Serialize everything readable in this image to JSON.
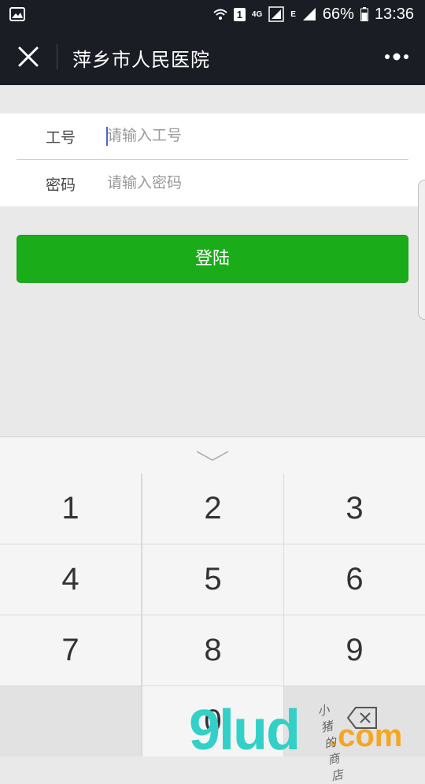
{
  "status_bar": {
    "sim_slot": "1",
    "network_type": "4G",
    "edge_label": "E",
    "battery": "66%",
    "time": "13:36"
  },
  "header": {
    "title": "萍乡市人民医院"
  },
  "form": {
    "id_label": "工号",
    "id_placeholder": "请输入工号",
    "password_label": "密码",
    "password_placeholder": "请输入密码"
  },
  "login_label": "登陆",
  "keyboard": {
    "keys": [
      "1",
      "2",
      "3",
      "4",
      "5",
      "6",
      "7",
      "8",
      "9",
      "0"
    ]
  },
  "watermark": {
    "main": "9lud",
    "domain": ".com",
    "script": "小猪的商店"
  },
  "colors": {
    "header_bg": "#1a1d24",
    "primary_green": "#1aad19",
    "page_bg": "#e9e9e9"
  }
}
